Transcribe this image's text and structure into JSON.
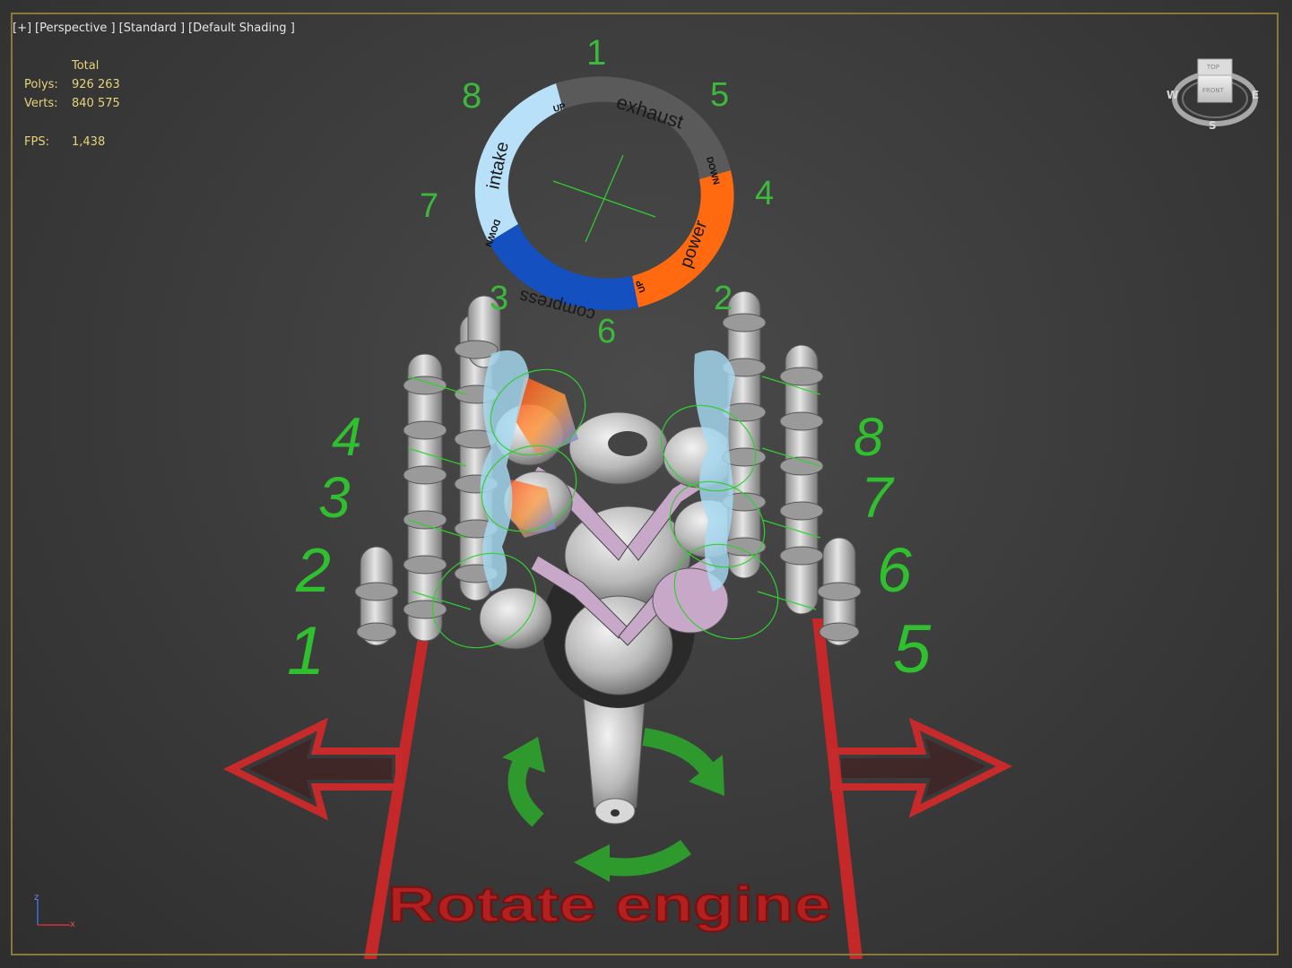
{
  "viewport": {
    "menu": [
      "[+]",
      "[Perspective ]",
      "[Standard ]",
      "[Default Shading ]"
    ]
  },
  "stats": {
    "header": "Total",
    "polys_label": "Polys:",
    "polys_value": "926 263",
    "verts_label": "Verts:",
    "verts_value": "840 575",
    "fps_label": "FPS:",
    "fps_value": "1,438"
  },
  "cycle_ring": {
    "labels": {
      "exhaust": "exhaust",
      "power": "power",
      "compress": "compress",
      "intake": "intake"
    },
    "markers": {
      "up_top": "UP",
      "down_right": "DOWN",
      "up_bottom": "UP",
      "down_left": "DOWN"
    },
    "firing_order": {
      "top": "1",
      "top_right": "5",
      "right": "4",
      "bottom_right": "2",
      "bottom": "6",
      "bottom_left": "3",
      "left": "7",
      "top_left": "8"
    },
    "colors": {
      "exhaust": "#5a5a5a",
      "power": "#ff6a10",
      "compress": "#1550c0",
      "intake": "#b8e0f8"
    }
  },
  "cylinders": {
    "left_bank": [
      "4",
      "3",
      "2",
      "1"
    ],
    "right_bank": [
      "8",
      "7",
      "6",
      "5"
    ]
  },
  "rotate_label": "Rotate engine",
  "viewcube": {
    "top": "TOP",
    "front": "FRONT",
    "w": "W",
    "e": "E",
    "s": "S"
  },
  "axis": {
    "z": "z",
    "x": "x"
  }
}
